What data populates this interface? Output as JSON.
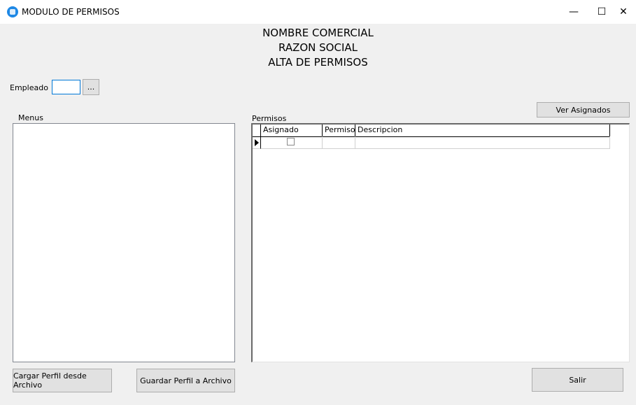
{
  "window": {
    "title": "MODULO DE PERMISOS",
    "controls": {
      "minimize": "—",
      "maximize": "☐",
      "close": "✕"
    }
  },
  "header": {
    "line1": "NOMBRE COMERCIAL",
    "line2": "RAZON SOCIAL",
    "line3": "ALTA DE PERMISOS"
  },
  "empleado": {
    "label": "Empleado",
    "value": "",
    "browse_label": "..."
  },
  "menus": {
    "label": "Menus",
    "items": []
  },
  "permisos": {
    "label": "Permisos",
    "ver_asignados_label": "Ver Asignados",
    "columns": [
      "Asignado",
      "Permiso",
      "Descripcion"
    ],
    "rows": [
      {
        "asignado": false,
        "permiso": "",
        "descripcion": ""
      }
    ]
  },
  "footer": {
    "cargar_label": "Cargar Perfil desde Archivo",
    "guardar_label": "Guardar Perfil a Archivo",
    "salir_label": "Salir"
  }
}
